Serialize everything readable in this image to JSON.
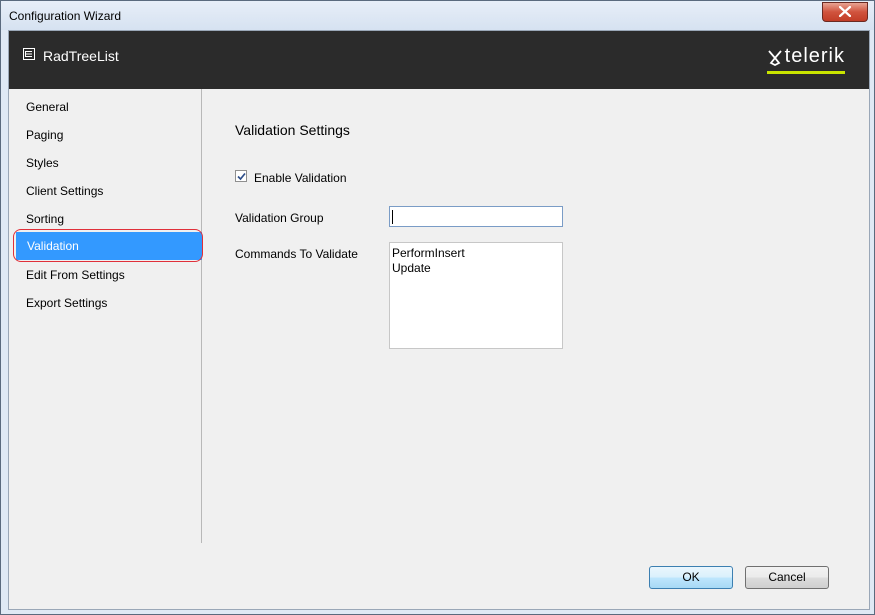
{
  "window": {
    "title": "Configuration Wizard"
  },
  "header": {
    "title": "RadTreeList",
    "logo_text": "telerik",
    "logo_accent": "#c9e400"
  },
  "sidebar": {
    "items": [
      {
        "label": "General",
        "selected": false
      },
      {
        "label": "Paging",
        "selected": false
      },
      {
        "label": "Styles",
        "selected": false
      },
      {
        "label": "Client Settings",
        "selected": false
      },
      {
        "label": "Sorting",
        "selected": false
      },
      {
        "label": "Validation",
        "selected": true
      },
      {
        "label": "Edit From Settings",
        "selected": false
      },
      {
        "label": "Export Settings",
        "selected": false
      }
    ],
    "selected_color": "#3399ff",
    "highlight_color": "#e0303a"
  },
  "main": {
    "section_title": "Validation Settings",
    "enable_validation": {
      "label": "Enable Validation",
      "checked": true
    },
    "validation_group": {
      "label": "Validation Group",
      "value": ""
    },
    "commands": {
      "label": "Commands To Validate",
      "items": [
        "PerformInsert",
        "Update"
      ]
    }
  },
  "footer": {
    "ok_label": "OK",
    "cancel_label": "Cancel"
  }
}
